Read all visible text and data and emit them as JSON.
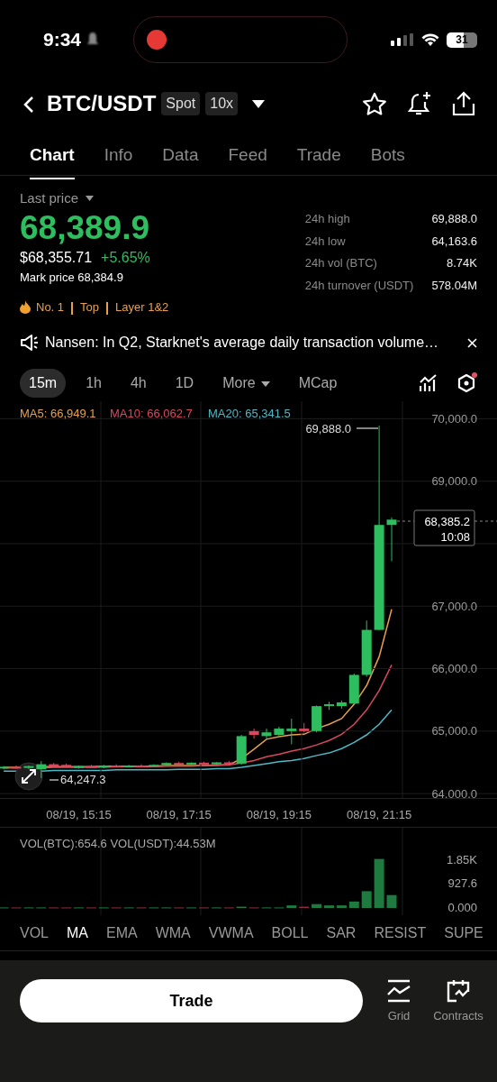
{
  "status_bar": {
    "time": "9:34",
    "battery": "31"
  },
  "header": {
    "pair": "BTC/USDT",
    "badges": [
      "Spot",
      "10x"
    ]
  },
  "tabs": [
    {
      "label": "Chart",
      "selected": true
    },
    {
      "label": "Info",
      "selected": false
    },
    {
      "label": "Data",
      "selected": false
    },
    {
      "label": "Feed",
      "selected": false
    },
    {
      "label": "Trade",
      "selected": false
    },
    {
      "label": "Bots",
      "selected": false
    }
  ],
  "price": {
    "label": "Last price",
    "last": "68,389.9",
    "fiat": "$68,355.71",
    "change": "+5.65%",
    "mark": "Mark price 68,384.9",
    "tags": [
      "No. 1",
      "Top",
      "Layer 1&2"
    ]
  },
  "stats": [
    {
      "label": "24h high",
      "value": "69,888.0"
    },
    {
      "label": "24h low",
      "value": "64,163.6"
    },
    {
      "label": "24h vol (BTC)",
      "value": "8.74K"
    },
    {
      "label": "24h turnover (USDT)",
      "value": "578.04M"
    }
  ],
  "announcement": {
    "text": "Nansen: In Q2, Starknet's average daily transaction volume…"
  },
  "timeframes": [
    {
      "label": "15m",
      "selected": true,
      "kind": "option"
    },
    {
      "label": "1h",
      "selected": false,
      "kind": "option"
    },
    {
      "label": "4h",
      "selected": false,
      "kind": "option"
    },
    {
      "label": "1D",
      "selected": false,
      "kind": "option"
    },
    {
      "label": "More",
      "selected": false,
      "kind": "menu"
    },
    {
      "label": "MCap",
      "selected": false,
      "kind": "option"
    }
  ],
  "chart": {
    "ma_legend": [
      {
        "label": "MA5: 66,949.1",
        "color": "#e8a04c"
      },
      {
        "label": "MA10: 66,062.7",
        "color": "#d9485f"
      },
      {
        "label": "MA20: 65,341.5",
        "color": "#4fb8c4"
      }
    ],
    "high_marker": "69,888.0",
    "low_marker": "64,247.3",
    "last_price": "68,385.2",
    "countdown": "10:08",
    "chart_data": {
      "type": "candlestick",
      "categories": [
        null,
        null,
        null,
        null,
        null,
        null,
        "08/19, 15:15",
        null,
        null,
        null,
        null,
        null,
        null,
        null,
        "08/19, 17:15",
        null,
        null,
        null,
        null,
        null,
        null,
        null,
        "08/19, 19:15",
        null,
        null,
        null,
        null,
        null,
        null,
        null,
        "08/19, 21:15",
        null
      ],
      "ylim": [
        63930,
        70280
      ],
      "grid": true,
      "ohlc": [
        [
          64410,
          64440,
          64390,
          64430
        ],
        [
          64430,
          64450,
          64400,
          64420
        ],
        [
          64420,
          64450,
          64390,
          64440
        ],
        [
          64390,
          64520,
          64247.3,
          64470
        ],
        [
          64470,
          64490,
          64420,
          64430
        ],
        [
          64460,
          64480,
          64420,
          64430
        ],
        [
          64430,
          64450,
          64400,
          64440
        ],
        [
          64440,
          64460,
          64420,
          64430
        ],
        [
          64430,
          64460,
          64410,
          64450
        ],
        [
          64450,
          64470,
          64430,
          64440
        ],
        [
          64440,
          64460,
          64420,
          64450
        ],
        [
          64450,
          64470,
          64430,
          64440
        ],
        [
          64440,
          64470,
          64430,
          64460
        ],
        [
          64460,
          64500,
          64450,
          64490
        ],
        [
          64490,
          64510,
          64470,
          64480
        ],
        [
          64480,
          64500,
          64460,
          64495
        ],
        [
          64495,
          64510,
          64470,
          64475
        ],
        [
          64475,
          64505,
          64465,
          64500
        ],
        [
          64500,
          64520,
          64480,
          64490
        ],
        [
          64480,
          64940,
          64460,
          64920
        ],
        [
          65000,
          65040,
          64880,
          64940
        ],
        [
          64920,
          65040,
          64880,
          64980
        ],
        [
          64940,
          65070,
          64920,
          65040
        ],
        [
          65000,
          65200,
          64790,
          65040
        ],
        [
          65040,
          65130,
          64980,
          65000
        ],
        [
          65000,
          65410,
          64980,
          65400
        ],
        [
          65410,
          65470,
          65340,
          65430
        ],
        [
          65400,
          65490,
          65360,
          65460
        ],
        [
          65440,
          65920,
          65430,
          65900
        ],
        [
          65900,
          66770,
          65870,
          66620
        ],
        [
          66620,
          69888,
          66620,
          68300
        ],
        [
          68300,
          68420,
          67720,
          68385.2
        ]
      ],
      "yticks": [
        {
          "value": 70000,
          "label": "70,000.0"
        },
        {
          "value": 69000,
          "label": "69,000.0"
        },
        {
          "value": 67000,
          "label": "67,000.0"
        },
        {
          "value": 66000,
          "label": "66,000.0"
        },
        {
          "value": 65000,
          "label": "65,000.0"
        },
        {
          "value": 64000,
          "label": "64,000.0"
        }
      ]
    }
  },
  "volume": {
    "legend": "VOL(BTC):654.6 VOL(USDT):44.53M",
    "chart_data": {
      "type": "bar",
      "categories": [
        null,
        null,
        null,
        null,
        null,
        null,
        null,
        null,
        null,
        null,
        null,
        null,
        null,
        null,
        null,
        null,
        null,
        null,
        null,
        null,
        null,
        null,
        null,
        null,
        null,
        null,
        null,
        null,
        null,
        null,
        null,
        null
      ],
      "ylim": [
        -280,
        3110
      ],
      "series": [
        {
          "values": [
            20,
            20,
            20,
            20,
            20,
            20,
            20,
            20,
            20,
            20,
            20,
            20,
            20,
            20,
            20,
            20,
            20,
            20,
            20,
            50,
            20,
            20,
            20,
            100,
            50,
            150,
            100,
            100,
            250,
            650,
            1900,
            500
          ]
        }
      ],
      "yticks": [
        {
          "value": 1850,
          "label": "1.85K"
        },
        {
          "value": 927.6,
          "label": "927.6"
        },
        {
          "value": 0,
          "label": "0.000"
        }
      ]
    }
  },
  "indicators": [
    {
      "label": "VOL",
      "selected": false
    },
    {
      "label": "MA",
      "selected": true
    },
    {
      "label": "EMA",
      "selected": false
    },
    {
      "label": "WMA",
      "selected": false
    },
    {
      "label": "VWMA",
      "selected": false
    },
    {
      "label": "BOLL",
      "selected": false
    },
    {
      "label": "SAR",
      "selected": false
    },
    {
      "label": "RESIST",
      "selected": false
    },
    {
      "label": "SUPE",
      "selected": false
    }
  ],
  "bottom_bar": {
    "trade": "Trade",
    "actions": [
      {
        "label": "Grid",
        "kind": "grid"
      },
      {
        "label": "Contracts",
        "kind": "contracts"
      }
    ]
  }
}
